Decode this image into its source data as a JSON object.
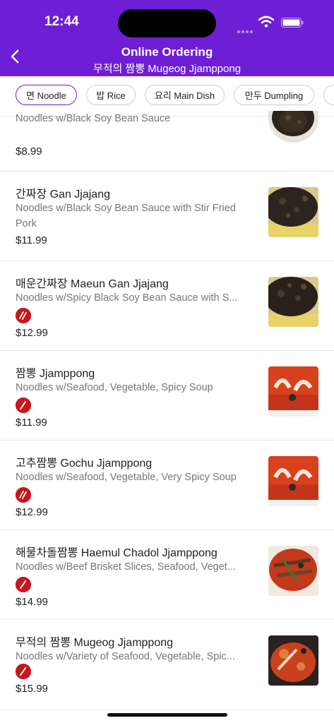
{
  "status": {
    "time": "12:44"
  },
  "header": {
    "title": "Online Ordering",
    "subtitle": "무적의 짬뽕 Mugeog Jjamppong",
    "bg_color": "#6e1fd6"
  },
  "categories": [
    {
      "label": "면 Noodle",
      "active": true
    },
    {
      "label": "밥 Rice",
      "active": false
    },
    {
      "label": "요리 Main Dish",
      "active": false
    },
    {
      "label": "만두 Dumpling",
      "active": false
    }
  ],
  "items": [
    {
      "name": "",
      "desc": "Noodles w/Black Soy Bean Sauce",
      "price": "$8.99",
      "spicy": 0
    },
    {
      "name": "간짜장 Gan Jjajang",
      "desc": "Noodles w/Black Soy Bean Sauce with Stir Fried Pork",
      "price": "$11.99",
      "spicy": 0
    },
    {
      "name": "매운간짜장 Maeun Gan Jjajang",
      "desc": "Noodles w/Spicy Black Soy Bean Sauce with S...",
      "price": "$12.99",
      "spicy": 2
    },
    {
      "name": "짬뽕 Jjamppong",
      "desc": "Noodles w/Seafood, Vegetable, Spicy Soup",
      "price": "$11.99",
      "spicy": 1
    },
    {
      "name": "고추짬뽕 Gochu Jjamppong",
      "desc": "Noodles w/Seafood, Vegetable, Very Spicy Soup",
      "price": "$12.99",
      "spicy": 2
    },
    {
      "name": "해물차돌짬뽕 Haemul Chadol Jjamppong",
      "desc": "Noodles w/Beef Brisket Slices, Seafood, Veget...",
      "price": "$14.99",
      "spicy": 1
    },
    {
      "name": "무적의 짬뽕  Mugeog Jjamppong",
      "desc": "Noodles w/Variety of Seafood, Vegetable, Spic...",
      "price": "$15.99",
      "spicy": 1
    }
  ],
  "colors": {
    "accent": "#6e1fd6",
    "spicy": "#c8161d",
    "muted": "#777777"
  }
}
